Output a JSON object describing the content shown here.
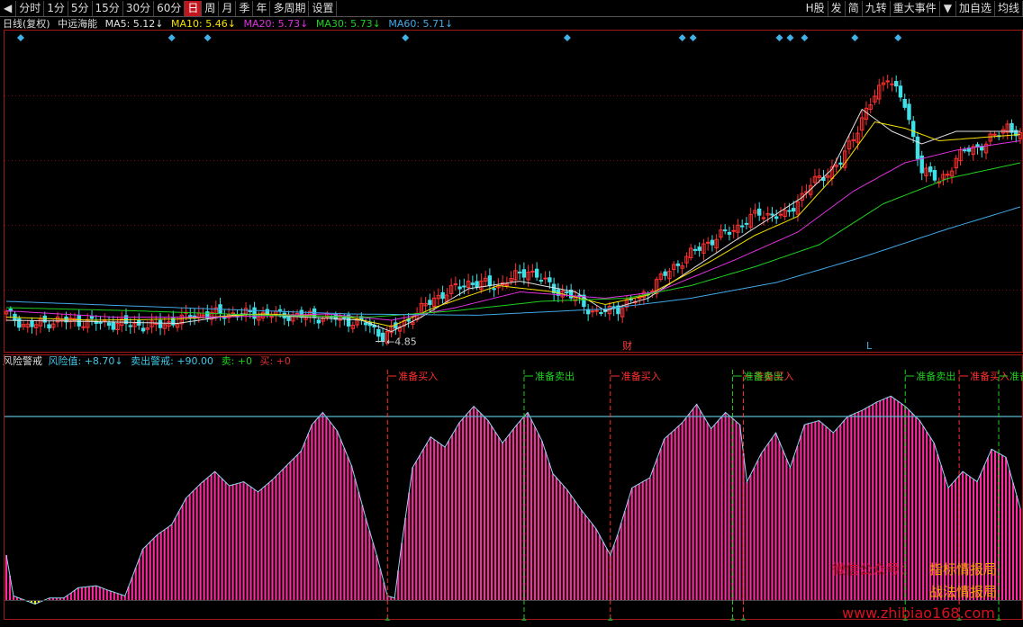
{
  "toolbar": {
    "left": [
      "分时",
      "1分",
      "5分",
      "15分",
      "30分",
      "60分",
      "日",
      "周",
      "月",
      "季",
      "年",
      "多周期",
      "设置"
    ],
    "active": "日",
    "right": [
      "H股",
      "发",
      "简",
      "九转",
      "重大事件",
      "加自选",
      "均线"
    ]
  },
  "price_header": {
    "period": "日线(复权)",
    "name": "中远海能",
    "ma": [
      {
        "label": "MA5: 5.12↓",
        "color": "#e0e0e0"
      },
      {
        "label": "MA10: 5.46↓",
        "color": "#f5e000"
      },
      {
        "label": "MA20: 5.73↓",
        "color": "#e030e0"
      },
      {
        "label": "MA30: 5.73↓",
        "color": "#20d020"
      },
      {
        "label": "MA60: 5.71↓",
        "color": "#40a8e8"
      }
    ]
  },
  "indicator_header": {
    "name": "风险警戒",
    "items": [
      {
        "label": "风险值: +8.70↓",
        "color": "#40c8e8"
      },
      {
        "label": "卖出警戒: +90.00",
        "color": "#40c8e8"
      },
      {
        "label": "卖: +0",
        "color": "#20d020"
      },
      {
        "label": "买: +0",
        "color": "#e03030"
      }
    ]
  },
  "markers": {
    "low_label": "4.85",
    "finance_label": "财",
    "l_label": "L"
  },
  "watermark": {
    "wechat": "微信公众号：",
    "line1": "指标情报局",
    "line2": "战法情报局",
    "url": "www.zhibiao168.com"
  },
  "colors": {
    "up": "#ff3030",
    "down": "#40e0e8",
    "risk": "#ff2aa0",
    "buy": "#ff3030",
    "sell": "#20d020",
    "threshold": "#5ab8d0"
  },
  "chart_data": [
    {
      "type": "candlestick",
      "title": "",
      "x_count": 238,
      "ylim": [
        4.6,
        9.7
      ],
      "min_marked": 4.85,
      "ma_keypoints": {
        "ma5": [
          [
            0,
            5.1
          ],
          [
            20,
            5.08
          ],
          [
            40,
            5.05
          ],
          [
            55,
            5.2
          ],
          [
            70,
            5.15
          ],
          [
            83,
            5.1
          ],
          [
            90,
            4.92
          ],
          [
            97,
            5.15
          ],
          [
            108,
            5.6
          ],
          [
            120,
            5.72
          ],
          [
            133,
            5.55
          ],
          [
            140,
            5.25
          ],
          [
            150,
            5.45
          ],
          [
            160,
            5.9
          ],
          [
            170,
            6.35
          ],
          [
            178,
            6.7
          ],
          [
            186,
            7.05
          ],
          [
            193,
            7.5
          ],
          [
            200,
            8.45
          ],
          [
            207,
            8.1
          ],
          [
            214,
            7.9
          ],
          [
            222,
            8.1
          ],
          [
            237,
            8.1
          ]
        ],
        "ma10": [
          [
            0,
            5.15
          ],
          [
            20,
            5.1
          ],
          [
            40,
            5.12
          ],
          [
            60,
            5.2
          ],
          [
            80,
            5.15
          ],
          [
            90,
            5.0
          ],
          [
            100,
            5.3
          ],
          [
            115,
            5.65
          ],
          [
            128,
            5.55
          ],
          [
            140,
            5.35
          ],
          [
            150,
            5.5
          ],
          [
            165,
            6.05
          ],
          [
            175,
            6.45
          ],
          [
            185,
            6.75
          ],
          [
            195,
            7.5
          ],
          [
            203,
            8.25
          ],
          [
            210,
            8.15
          ],
          [
            218,
            7.95
          ],
          [
            237,
            8.05
          ]
        ],
        "ma20": [
          [
            0,
            5.25
          ],
          [
            25,
            5.15
          ],
          [
            50,
            5.15
          ],
          [
            75,
            5.2
          ],
          [
            90,
            5.1
          ],
          [
            105,
            5.3
          ],
          [
            120,
            5.55
          ],
          [
            140,
            5.45
          ],
          [
            152,
            5.55
          ],
          [
            170,
            6.05
          ],
          [
            185,
            6.5
          ],
          [
            198,
            7.15
          ],
          [
            210,
            7.6
          ],
          [
            222,
            7.8
          ],
          [
            237,
            7.95
          ]
        ],
        "ma30": [
          [
            0,
            5.3
          ],
          [
            30,
            5.25
          ],
          [
            60,
            5.18
          ],
          [
            85,
            5.15
          ],
          [
            105,
            5.25
          ],
          [
            125,
            5.4
          ],
          [
            145,
            5.45
          ],
          [
            160,
            5.65
          ],
          [
            175,
            5.95
          ],
          [
            190,
            6.3
          ],
          [
            205,
            6.95
          ],
          [
            220,
            7.35
          ],
          [
            237,
            7.6
          ]
        ],
        "ma60": [
          [
            0,
            5.4
          ],
          [
            40,
            5.3
          ],
          [
            80,
            5.2
          ],
          [
            110,
            5.18
          ],
          [
            140,
            5.28
          ],
          [
            160,
            5.45
          ],
          [
            180,
            5.7
          ],
          [
            200,
            6.1
          ],
          [
            220,
            6.55
          ],
          [
            237,
            6.9
          ]
        ]
      },
      "close_keypoints": [
        [
          0,
          5.2
        ],
        [
          5,
          5.0
        ],
        [
          12,
          5.1
        ],
        [
          25,
          5.05
        ],
        [
          35,
          5.0
        ],
        [
          45,
          5.2
        ],
        [
          60,
          5.2
        ],
        [
          75,
          5.15
        ],
        [
          84,
          5.05
        ],
        [
          88,
          4.85
        ],
        [
          94,
          5.1
        ],
        [
          100,
          5.45
        ],
        [
          108,
          5.7
        ],
        [
          115,
          5.65
        ],
        [
          122,
          5.9
        ],
        [
          128,
          5.6
        ],
        [
          133,
          5.45
        ],
        [
          138,
          5.2
        ],
        [
          143,
          5.3
        ],
        [
          148,
          5.45
        ],
        [
          156,
          5.95
        ],
        [
          163,
          6.3
        ],
        [
          170,
          6.55
        ],
        [
          176,
          6.8
        ],
        [
          182,
          6.75
        ],
        [
          188,
          7.25
        ],
        [
          195,
          7.6
        ],
        [
          200,
          8.3
        ],
        [
          206,
          9.0
        ],
        [
          210,
          8.5
        ],
        [
          214,
          7.5
        ],
        [
          218,
          7.3
        ],
        [
          224,
          7.8
        ],
        [
          229,
          7.9
        ],
        [
          234,
          8.2
        ],
        [
          237,
          8.0
        ]
      ],
      "signals": {
        "diamonds": [
          4,
          46,
          56,
          111,
          156,
          188,
          191,
          215,
          218,
          222,
          236,
          248
        ],
        "buy": [
          106,
          168,
          205,
          265
        ],
        "sell": [
          144,
          202,
          250,
          276
        ]
      }
    },
    {
      "type": "bar",
      "title": "",
      "ylim": [
        0,
        120
      ],
      "threshold": 90,
      "risk_keypoints": [
        [
          0,
          22
        ],
        [
          2,
          2
        ],
        [
          8,
          -2
        ],
        [
          12,
          1
        ],
        [
          16,
          1
        ],
        [
          20,
          6
        ],
        [
          25,
          7
        ],
        [
          28,
          5
        ],
        [
          33,
          2
        ],
        [
          38,
          25
        ],
        [
          42,
          32
        ],
        [
          46,
          37
        ],
        [
          50,
          50
        ],
        [
          54,
          57
        ],
        [
          58,
          63
        ],
        [
          62,
          56
        ],
        [
          66,
          58
        ],
        [
          70,
          53
        ],
        [
          74,
          59
        ],
        [
          78,
          66
        ],
        [
          82,
          73
        ],
        [
          85,
          86
        ],
        [
          88,
          92
        ],
        [
          92,
          83
        ],
        [
          96,
          66
        ],
        [
          100,
          40
        ],
        [
          103,
          22
        ],
        [
          106,
          2
        ],
        [
          108,
          1
        ],
        [
          110,
          28
        ],
        [
          113,
          65
        ],
        [
          118,
          80
        ],
        [
          122,
          75
        ],
        [
          126,
          87
        ],
        [
          130,
          95
        ],
        [
          134,
          88
        ],
        [
          138,
          77
        ],
        [
          142,
          86
        ],
        [
          145,
          92
        ],
        [
          149,
          78
        ],
        [
          152,
          62
        ],
        [
          156,
          54
        ],
        [
          160,
          44
        ],
        [
          164,
          35
        ],
        [
          168,
          22
        ],
        [
          170,
          32
        ],
        [
          174,
          55
        ],
        [
          179,
          60
        ],
        [
          183,
          79
        ],
        [
          188,
          87
        ],
        [
          192,
          96
        ],
        [
          196,
          84
        ],
        [
          200,
          92
        ],
        [
          204,
          86
        ],
        [
          206,
          58
        ],
        [
          210,
          72
        ],
        [
          214,
          82
        ],
        [
          218,
          65
        ],
        [
          222,
          86
        ],
        [
          226,
          88
        ],
        [
          230,
          82
        ],
        [
          234,
          90
        ],
        [
          238,
          93
        ],
        [
          242,
          97
        ],
        [
          246,
          100
        ],
        [
          250,
          95
        ],
        [
          254,
          88
        ],
        [
          258,
          77
        ],
        [
          262,
          55
        ],
        [
          266,
          63
        ],
        [
          270,
          58
        ],
        [
          274,
          74
        ],
        [
          278,
          70
        ],
        [
          282,
          45
        ]
      ]
    }
  ]
}
